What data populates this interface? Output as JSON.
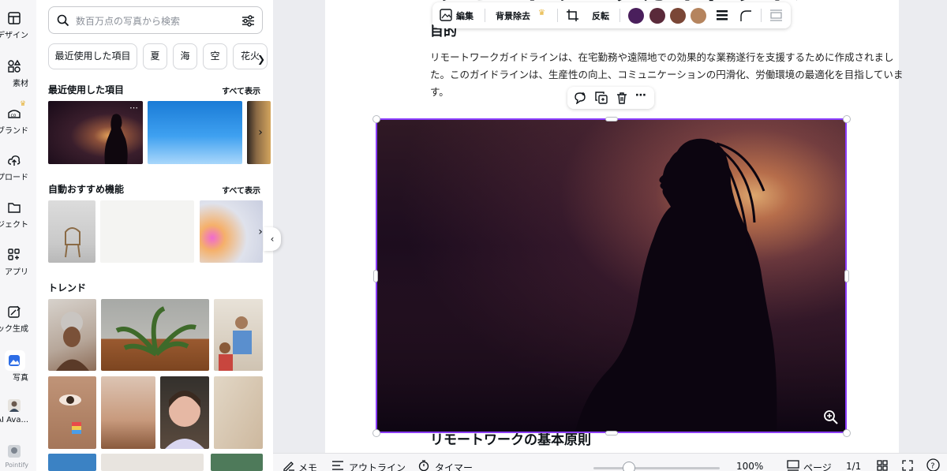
{
  "rail": {
    "items": [
      {
        "label": "デザイン",
        "icon": "layout-icon"
      },
      {
        "label": "素材",
        "icon": "shapes-icon"
      },
      {
        "label": "ブランド",
        "icon": "brand-icon"
      },
      {
        "label": "ップロード",
        "icon": "cloud-upload-icon"
      },
      {
        "label": "ロジェクト",
        "icon": "folder-icon"
      },
      {
        "label": "アプリ",
        "icon": "apps-icon"
      },
      {
        "label": "ジック生成",
        "icon": "magic-icon"
      },
      {
        "label": "写真",
        "icon": "photo-icon"
      },
      {
        "label": "D AI Ava...",
        "icon": "avatar-icon"
      },
      {
        "label": "Pointify",
        "icon": "pointify-icon"
      }
    ]
  },
  "panel": {
    "search_placeholder": "数百万点の写真から検索",
    "chips": [
      "最近使用した項目",
      "夏",
      "海",
      "空",
      "花火"
    ],
    "recent": {
      "title": "最近使用した項目",
      "link": "すべて表示"
    },
    "auto": {
      "title": "自動おすすめ機能",
      "link": "すべて表示"
    },
    "trend": {
      "title": "トレンド"
    }
  },
  "toolbar": {
    "edit": "編集",
    "bg_remove": "背景除去",
    "flip": "反転",
    "swatches": [
      "#4a1f5c",
      "#5a2a3a",
      "#7a4636",
      "#b5845e"
    ]
  },
  "doc": {
    "title": "リモートワークガイドライン",
    "heading1": "目的",
    "paragraph": "リモートワークガイドラインは、在宅勤務や遠隔地での効果的な業務遂行を支援するために作成されました。このガイドラインは、生産性の向上、コミュニケーションの円滑化、労働環境の最適化を目指しています。",
    "heading2": "リモートワークの基本原則"
  },
  "bottombar": {
    "memo": "メモ",
    "outline": "アウトライン",
    "timer": "タイマー",
    "zoom": "100%",
    "zoom_level": 0.28,
    "page_label": "ページ",
    "page_count": "1/1"
  },
  "colors": {
    "accent": "#8b3dff",
    "crown": "#e7b43a"
  }
}
